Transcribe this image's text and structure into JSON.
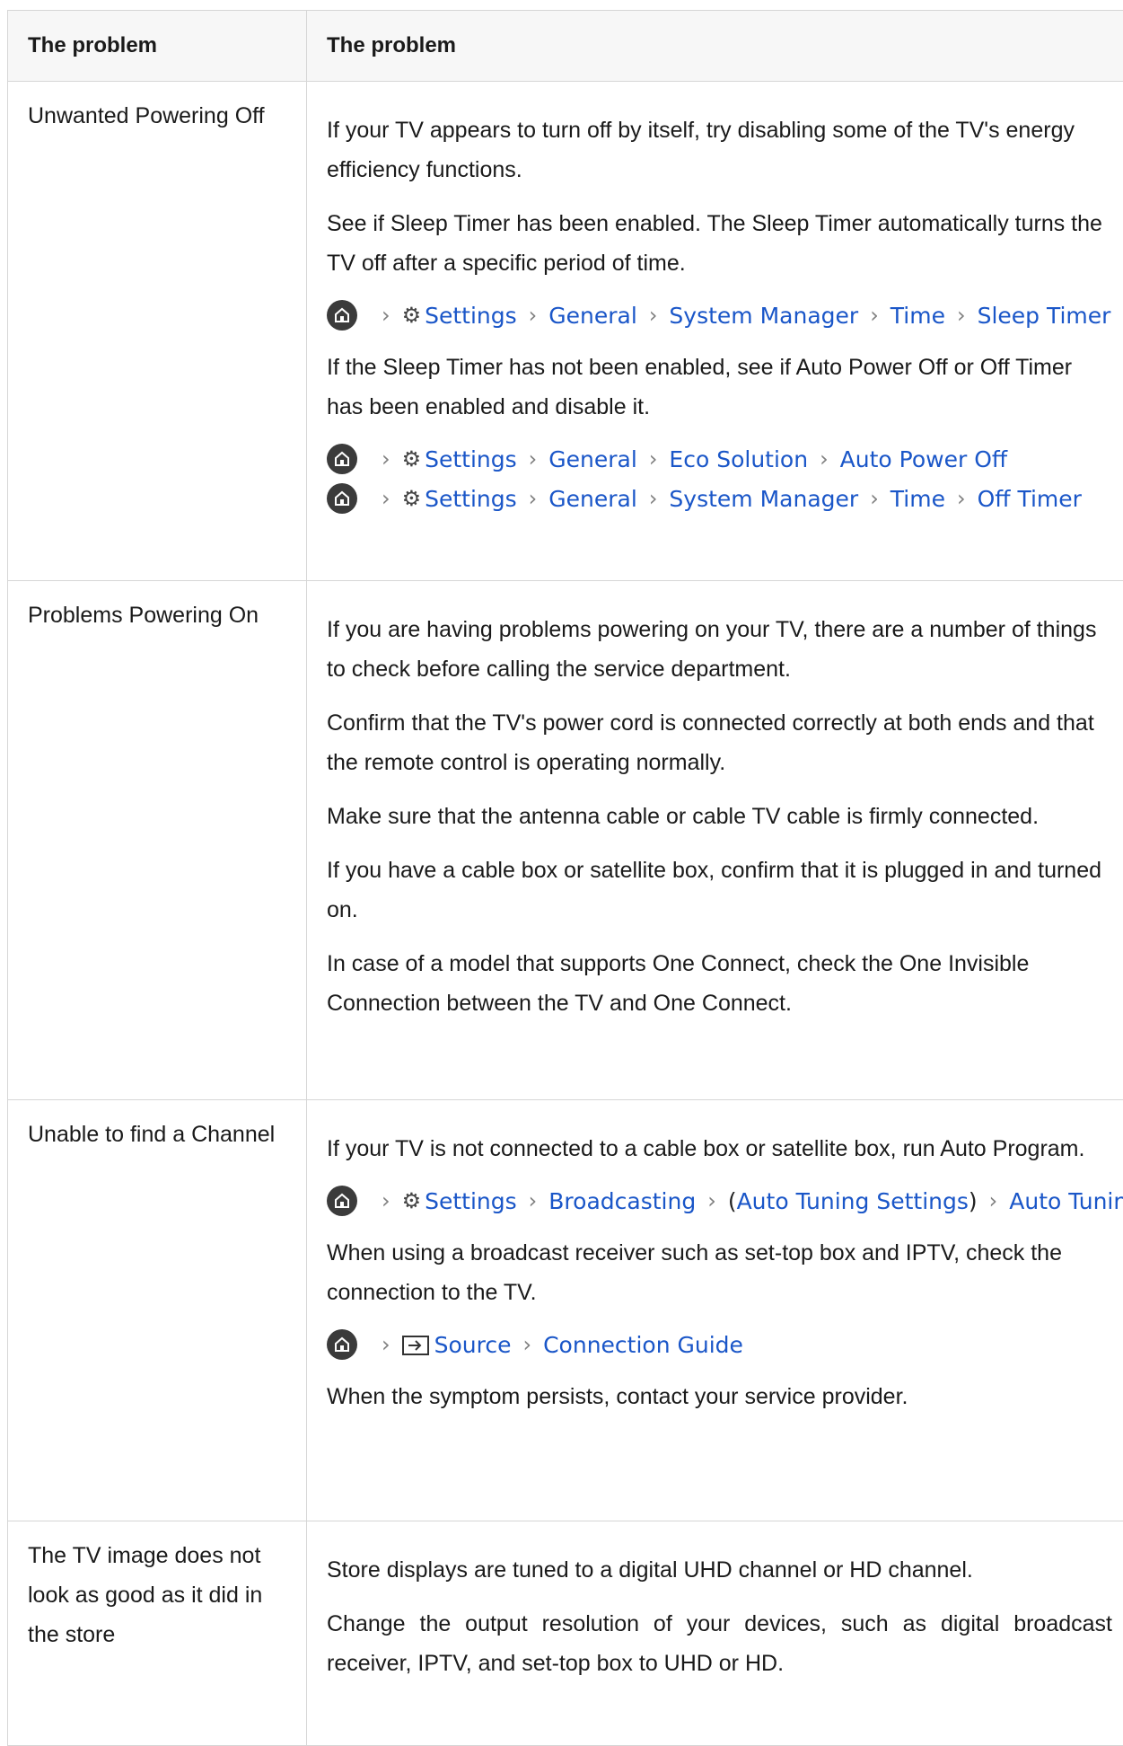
{
  "header": {
    "col1": "The problem",
    "col2": "The problem"
  },
  "rows": [
    {
      "problem": "Unwanted Powering Off",
      "paras": [
        "If your TV appears to turn off by itself, try disabling some of the TV's energy efficiency functions.",
        "See if Sleep Timer has been enabled. The Sleep Timer automatically turns the TV off after a specific period of time.",
        "If the Sleep Timer has not been enabled, see if Auto Power Off or Off Timer has been enabled and disable it."
      ],
      "path1": [
        "Settings",
        "General",
        "System Manager",
        "Time",
        "Sleep Timer"
      ],
      "path2": [
        "Settings",
        "General",
        "Eco Solution",
        "Auto Power Off"
      ],
      "path3": [
        "Settings",
        "General",
        "System Manager",
        "Time",
        "Off Timer"
      ]
    },
    {
      "problem": "Problems Powering On",
      "paras": [
        "If you are having problems powering on your TV, there are a number of things to check before calling the service department.",
        "Confirm that the TV's power cord is connected correctly at both ends and that the remote control is operating normally.",
        "Make sure that the antenna cable or cable TV cable is firmly connected.",
        "If you have a cable box or satellite box, confirm that it is plugged in and turned on.",
        "In case of a model that supports One Connect, check the One Invisible Connection between the TV and One Connect."
      ]
    },
    {
      "problem": "Unable to find a Channel",
      "paras": [
        "If your TV is not connected to a cable box or satellite box, run Auto Program.",
        "When using a broadcast receiver such as set-top box and IPTV, check the connection to the TV.",
        "When the symptom persists, contact your service provider."
      ],
      "path1": [
        "Settings",
        "Broadcasting",
        "Auto Tuning Settings",
        "Auto Tuning"
      ],
      "path2": [
        "Source",
        "Connection Guide"
      ],
      "paren_open": "(",
      "paren_close": ")"
    },
    {
      "problem": "The TV image does not look as good as it did in the store",
      "paras": [
        "Store displays are tuned to a digital UHD channel or HD channel.",
        "Change the output resolution of your devices, such as digital broadcast receiver, IPTV, and set-top box to UHD or HD."
      ]
    }
  ],
  "icons": {
    "home": "home-icon",
    "settings": "gear-icon",
    "source": "source-icon",
    "separator": "chevron-right-icon"
  },
  "colors": {
    "link": "#1a56c8",
    "border": "#d6d6d6",
    "header_bg": "#f7f7f7",
    "home_icon_bg": "#3b3b3b"
  }
}
